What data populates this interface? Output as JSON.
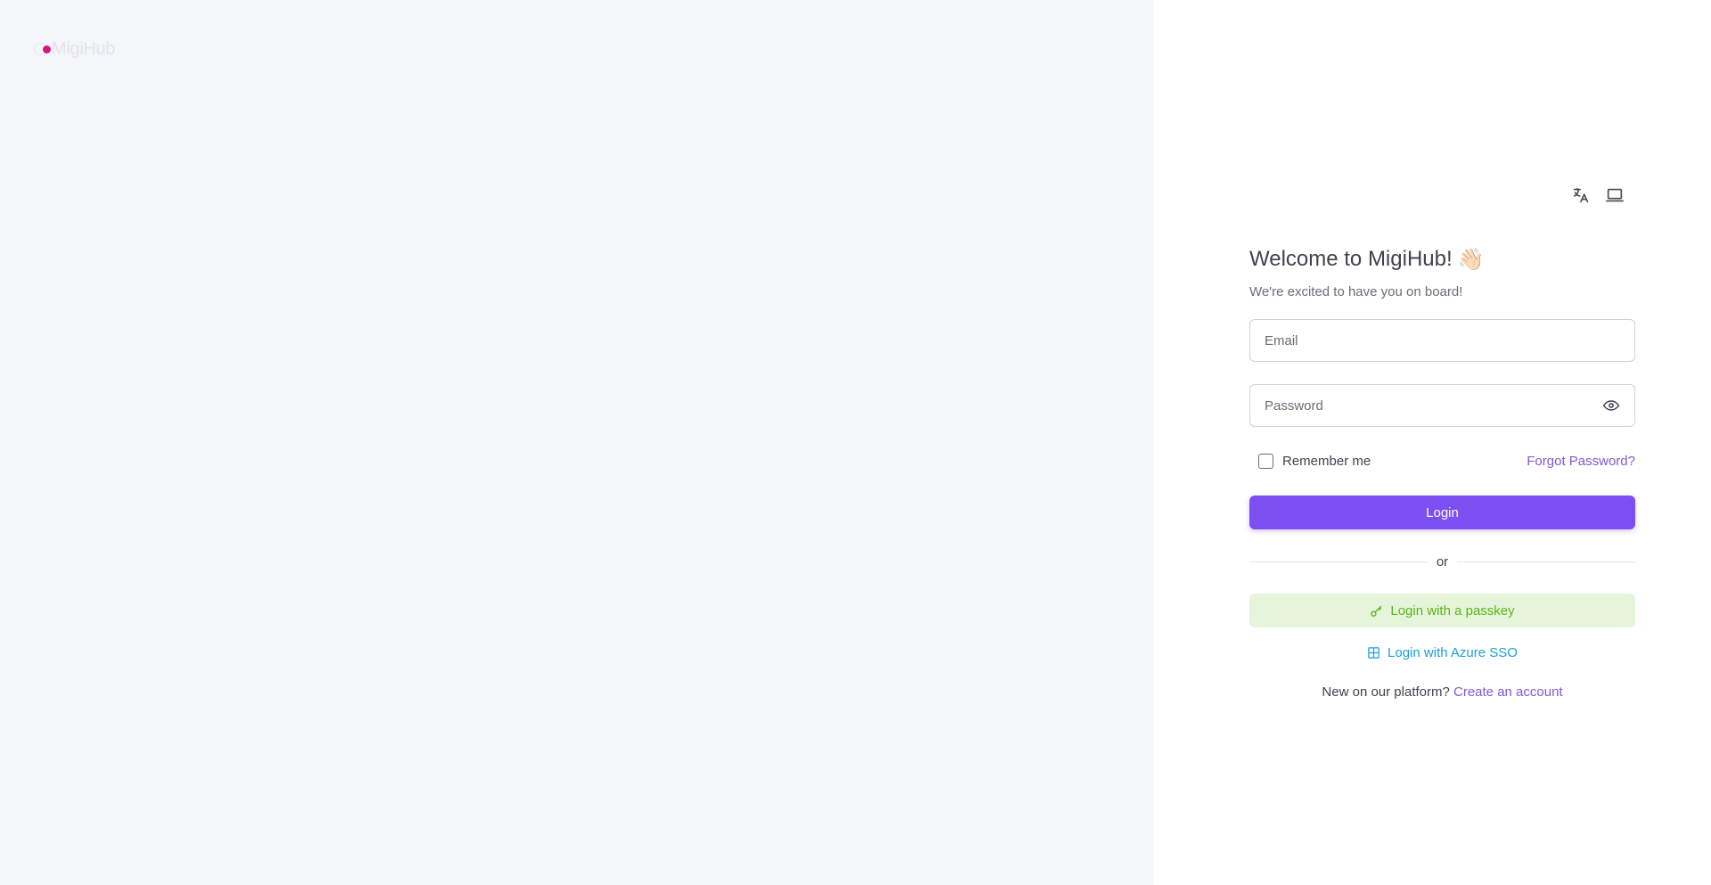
{
  "brand": {
    "name": "MigiHub",
    "accent_color": "#d4157f"
  },
  "toolbar": {
    "language_icon": "translate-icon",
    "theme_icon": "laptop-icon"
  },
  "login": {
    "title": "Welcome to MigiHub!",
    "title_emoji": "👋🏻",
    "subtitle": "We're excited to have you on board!",
    "email_placeholder": "Email",
    "password_placeholder": "Password",
    "remember_label": "Remember me",
    "forgot_label": "Forgot Password?",
    "login_label": "Login",
    "divider_label": "or",
    "passkey_label": "Login with a passkey",
    "azure_label": "Login with Azure SSO",
    "signup_prompt": "New on our platform?",
    "signup_link": "Create an account"
  },
  "colors": {
    "primary": "#7c4ff0",
    "success": "#5cb519",
    "success_bg": "#e6f5d9",
    "info": "#1ba1d9",
    "link": "#7d5bd0"
  }
}
